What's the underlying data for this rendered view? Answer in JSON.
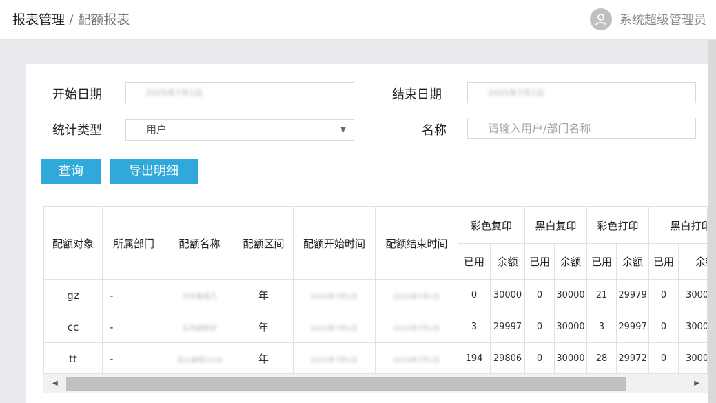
{
  "header": {
    "breadcrumb_root": "报表管理",
    "breadcrumb_sep": "/",
    "breadcrumb_current": "配额报表",
    "username": "系统超级管理员"
  },
  "filters": {
    "start_date_label": "开始日期",
    "start_date_value": "2025年7月1日",
    "end_date_label": "结束日期",
    "end_date_value": "2025年7月1日",
    "stat_type_label": "统计类型",
    "stat_type_value": "用户",
    "name_label": "名称",
    "name_placeholder": "请输入用户/部门名称"
  },
  "buttons": {
    "query": "查询",
    "export": "导出明细"
  },
  "table": {
    "headers": [
      "配额对象",
      "所属部门",
      "配额名称",
      "配额区间",
      "配额开始时间",
      "配额结束时间"
    ],
    "groups": [
      "彩色复印",
      "黑白复印",
      "彩色打印",
      "黑白打印"
    ],
    "sub_used": "已用",
    "sub_left": "余额",
    "rows": [
      {
        "target": "gz",
        "dept": "-",
        "name": "今天是周几",
        "period": "年",
        "start": "2025年7月1日",
        "end": "2025年7月1日",
        "v": [
          "0",
          "30000",
          "0",
          "30000",
          "21",
          "29979",
          "0",
          "3000"
        ]
      },
      {
        "target": "cc",
        "dept": "-",
        "name": "五月她家好",
        "period": "年",
        "start": "2025年7月1日",
        "end": "2025年7月1日",
        "v": [
          "3",
          "29997",
          "0",
          "30000",
          "3",
          "29997",
          "0",
          "3000"
        ]
      },
      {
        "target": "tt",
        "dept": "-",
        "name": "怎么做吧1234",
        "period": "年",
        "start": "2025年7月1日",
        "end": "2025年7月1日",
        "v": [
          "194",
          "29806",
          "0",
          "30000",
          "28",
          "29972",
          "0",
          "3000"
        ]
      }
    ]
  },
  "icons": {
    "avatar": "user-avatar-icon",
    "dropdown": "caret-down-icon",
    "scroll_left": "arrow-left-icon",
    "scroll_right": "arrow-right-icon"
  },
  "colors": {
    "accent": "#2fa9da",
    "background": "#e9ebee"
  }
}
